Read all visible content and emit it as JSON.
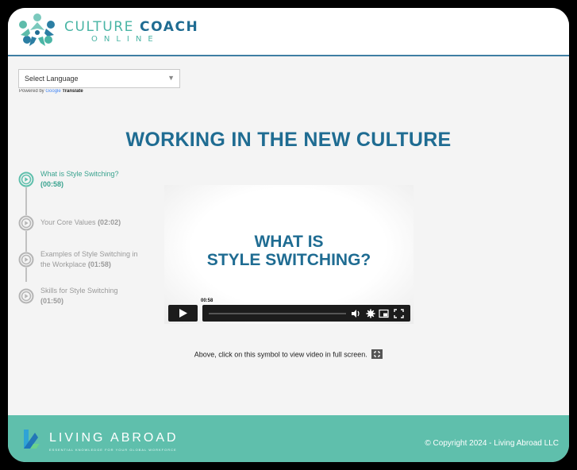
{
  "header": {
    "brand_line1_a": "CULTURE",
    "brand_line1_b": "COACH",
    "brand_line2": "ONLINE",
    "logo_icon": "people-circle-logo-icon"
  },
  "language": {
    "selected": "Select Language",
    "powered_prefix": "Powered by",
    "powered_google": "Google",
    "powered_suffix": "Translate"
  },
  "page": {
    "title": "WORKING IN THE NEW CULTURE"
  },
  "chapters": [
    {
      "label": "What is Style Switching?",
      "duration": "(00:58)",
      "active": true
    },
    {
      "label": "Your Core Values",
      "duration": "(02:02)",
      "active": false
    },
    {
      "label": "Examples of Style Switching in the Workplace",
      "duration": "(01:58)",
      "active": false
    },
    {
      "label": "Skills for Style Switching",
      "duration": "(01:50)",
      "active": false
    }
  ],
  "video": {
    "title_line1": "WHAT IS",
    "title_line2": "STYLE SWITCHING?",
    "time": "00:58"
  },
  "note": {
    "text": "Above, click on this symbol to view video in full screen."
  },
  "footer": {
    "brand": "LIVING ABROAD",
    "tagline": "ESSENTIAL KNOWLEDGE FOR YOUR GLOBAL WORKFORCE",
    "copyright": "© Copyright 2024 - Living Abroad LLC"
  },
  "colors": {
    "brand_blue": "#1f6c92",
    "brand_teal": "#4ab5a5",
    "footer_bg": "#5fbfac",
    "active_chapter": "#3aa38f"
  }
}
